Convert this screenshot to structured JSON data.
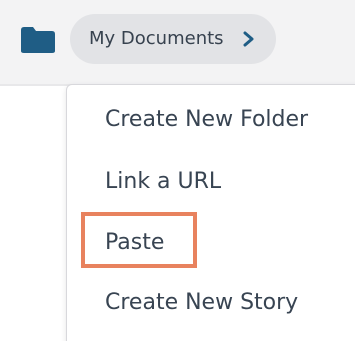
{
  "breadcrumb": {
    "folder_icon": "folder-icon",
    "label": "My Documents",
    "chevron_icon": "chevron-right-icon"
  },
  "context_menu": {
    "items": [
      {
        "label": "Create New Folder"
      },
      {
        "label": "Link a URL"
      },
      {
        "label": "Paste",
        "highlighted": true
      },
      {
        "label": "Create New Story"
      }
    ]
  },
  "colors": {
    "folder": "#1f5d85",
    "topbar_bg": "#f3f3f4",
    "pill_bg": "#e2e3e6",
    "text": "#384452",
    "highlight": "#e8825e"
  }
}
